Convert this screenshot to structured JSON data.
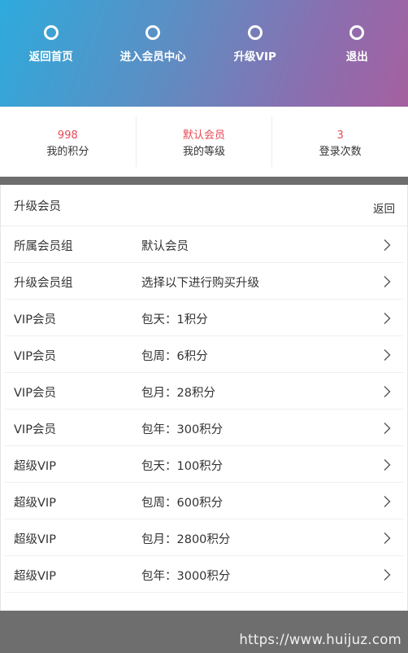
{
  "nav": {
    "items": [
      {
        "label": "返回首页",
        "icon": "circle-icon"
      },
      {
        "label": "进入会员中心",
        "icon": "circle-icon"
      },
      {
        "label": "升级VIP",
        "icon": "circle-icon"
      },
      {
        "label": "退出",
        "icon": "circle-icon"
      }
    ]
  },
  "stats": [
    {
      "value": "998",
      "label": "我的积分"
    },
    {
      "value": "默认会员",
      "label": "我的等级"
    },
    {
      "value": "3",
      "label": "登录次数"
    }
  ],
  "panel": {
    "title": "升级会员",
    "back_label": "返回",
    "rows": [
      {
        "label": "所属会员组",
        "value": "默认会员"
      },
      {
        "label": "升级会员组",
        "value": "选择以下进行购买升级"
      },
      {
        "label": "VIP会员",
        "value": "包天：1积分"
      },
      {
        "label": "VIP会员",
        "value": "包周：6积分"
      },
      {
        "label": "VIP会员",
        "value": "包月：28积分"
      },
      {
        "label": "VIP会员",
        "value": "包年：300积分"
      },
      {
        "label": "超级VIP",
        "value": "包天：100积分"
      },
      {
        "label": "超级VIP",
        "value": "包周：600积分"
      },
      {
        "label": "超级VIP",
        "value": "包月：2800积分"
      },
      {
        "label": "超级VIP",
        "value": "包年：3000积分"
      }
    ]
  },
  "footer": {
    "watermark": "https://www.huijuz.com"
  },
  "colors": {
    "accent_red": "#e84a55",
    "band_gray": "#6e6e6e"
  }
}
